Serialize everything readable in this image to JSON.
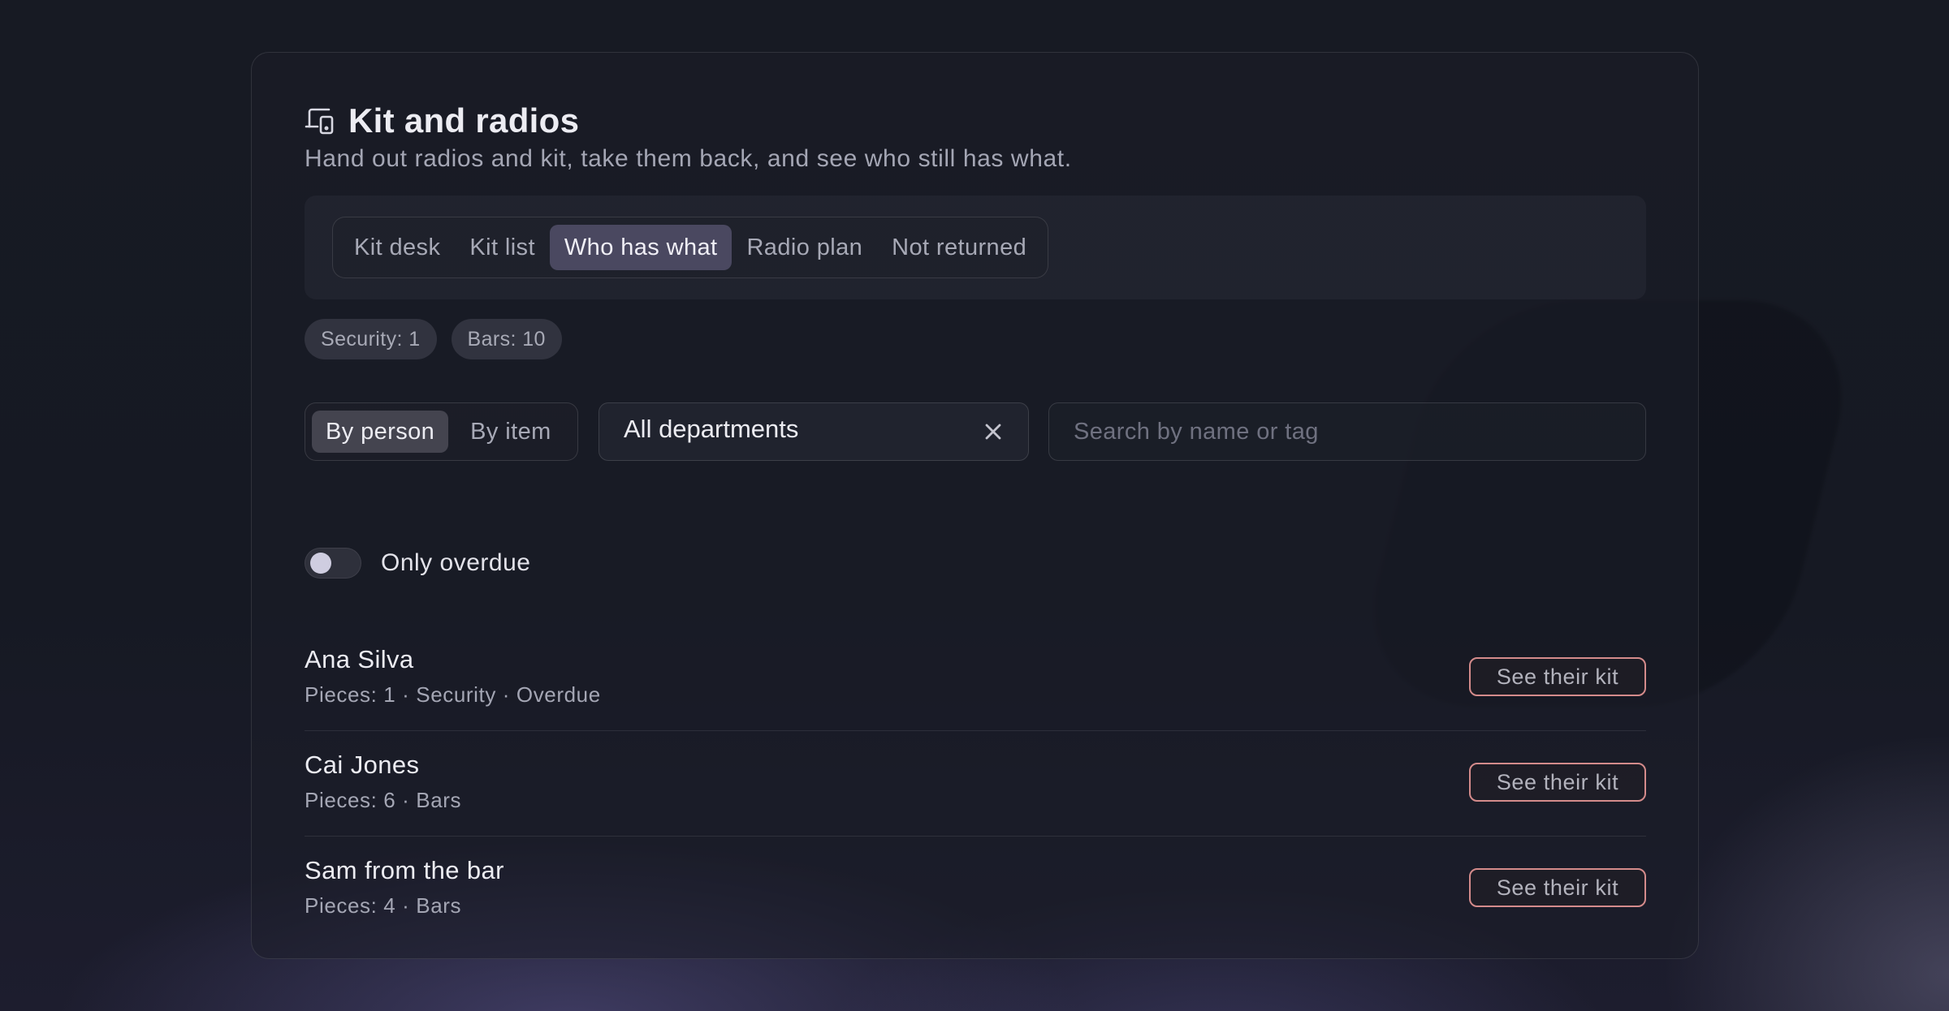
{
  "header": {
    "title": "Kit and radios",
    "subtitle": "Hand out radios and kit, take them back, and see who still has what.",
    "icon": "devices-icon"
  },
  "tabs": [
    {
      "label": "Kit desk",
      "active": false
    },
    {
      "label": "Kit list",
      "active": false
    },
    {
      "label": "Who has what",
      "active": true
    },
    {
      "label": "Radio plan",
      "active": false
    },
    {
      "label": "Not returned",
      "active": false
    }
  ],
  "chips": [
    {
      "label": "Security: 1"
    },
    {
      "label": "Bars: 10"
    }
  ],
  "view_toggle": {
    "options": [
      {
        "label": "By person",
        "active": true
      },
      {
        "label": "By item",
        "active": false
      }
    ]
  },
  "department_select": {
    "value": "All departments"
  },
  "search": {
    "placeholder": "Search by name or tag",
    "value": ""
  },
  "overdue_toggle": {
    "label": "Only overdue",
    "on": false
  },
  "people": [
    {
      "name": "Ana Silva",
      "meta": "Pieces: 1 · Security · Overdue",
      "action": "See their kit"
    },
    {
      "name": "Cai Jones",
      "meta": "Pieces: 6 · Bars",
      "action": "See their kit"
    },
    {
      "name": "Sam from the bar",
      "meta": "Pieces: 4 · Bars",
      "action": "See their kit"
    }
  ],
  "colors": {
    "accent_border": "#d48b8b",
    "active_tab": "#4a4860",
    "background": "#151821"
  }
}
